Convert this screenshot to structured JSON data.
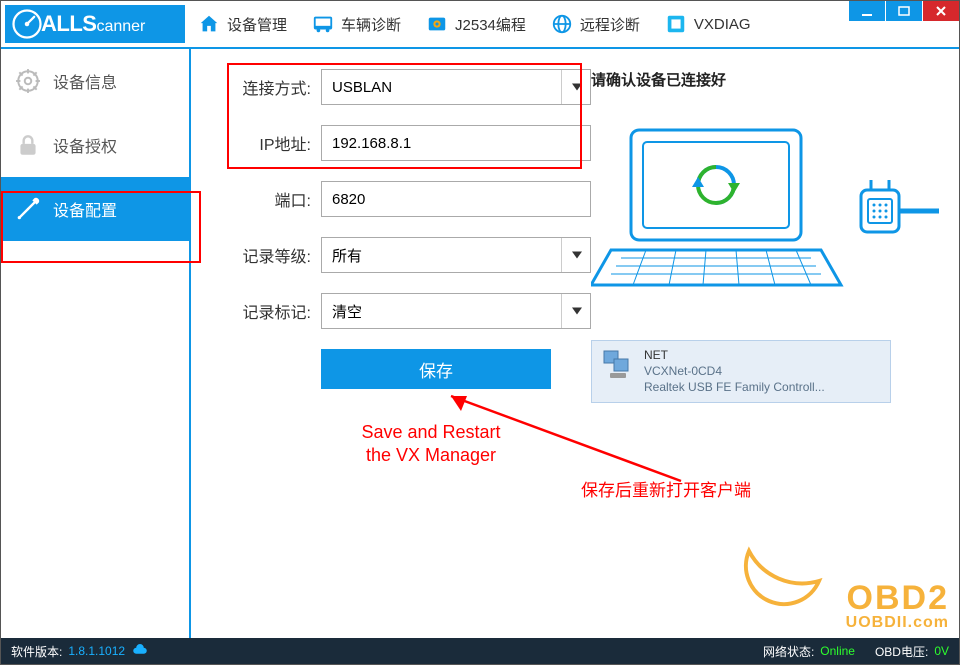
{
  "brand": {
    "bold": "ALLS",
    "rest": "canner"
  },
  "nav": {
    "device_mgmt": "设备管理",
    "vehicle_diag": "车辆诊断",
    "j2534": "J2534编程",
    "remote_diag": "远程诊断",
    "vxdiag": "VXDIAG"
  },
  "sidebar": {
    "info": "设备信息",
    "license": "设备授权",
    "config": "设备配置"
  },
  "form": {
    "conn_type_label": "连接方式:",
    "conn_type_value": "USBLAN",
    "ip_label": "IP地址:",
    "ip_value": "192.168.8.1",
    "port_label": "端口:",
    "port_value": "6820",
    "log_level_label": "记录等级:",
    "log_level_value": "所有",
    "log_mark_label": "记录标记:",
    "log_mark_value": "清空",
    "save_label": "保存"
  },
  "right": {
    "title": "请确认设备已连接好",
    "net_card": {
      "title": "NET",
      "line1": "VCXNet-0CD4",
      "line2": "Realtek USB FE Family Controll..."
    }
  },
  "annotation": {
    "en": "Save and Restart\nthe VX Manager",
    "cn": "保存后重新打开客户端"
  },
  "statusbar": {
    "version_label": "软件版本:",
    "version_value": "1.8.1.1012",
    "net_label": "网络状态:",
    "net_value": "Online",
    "obd_label": "OBD电压:",
    "obd_value": "0V"
  },
  "watermark": {
    "main": "OBD2",
    "sub": "UOBDII.com"
  }
}
